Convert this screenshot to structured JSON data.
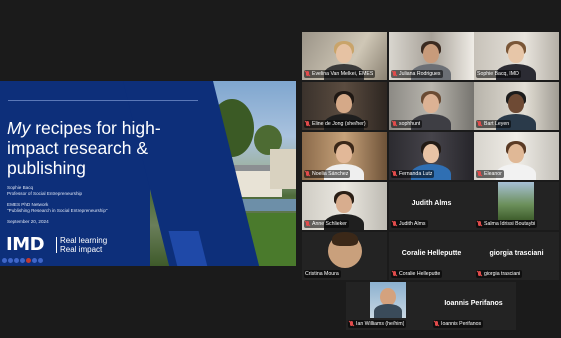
{
  "slide": {
    "title_italic": "My",
    "title_rest": " recipes for high-impact research & publishing",
    "presenter_name": "Sophie Bacq",
    "presenter_role": "Professor of Social Entrepreneurship",
    "network_line1": "EMES PhD Network",
    "network_line2": "\"Publishing Research in Social Entrepreneurship\"",
    "date": "September 20, 2024",
    "logo": "IMD",
    "tagline_1": "Real learning",
    "tagline_2": "Real impact"
  },
  "participants": [
    {
      "name": "Evelina Van Melkei, EMES",
      "video": true,
      "muted": true
    },
    {
      "name": "Juliana Rodrigues",
      "video": true,
      "muted": true
    },
    {
      "name": "Sophie Bacq, IMD",
      "video": true,
      "muted": false,
      "speaking": true
    },
    {
      "name": "Eline de Jong (she/her)",
      "video": true,
      "muted": true
    },
    {
      "name": "sophhunt",
      "video": true,
      "muted": true
    },
    {
      "name": "Bart Leyen",
      "video": true,
      "muted": true
    },
    {
      "name": "Noelia Sánchez",
      "video": true,
      "muted": true
    },
    {
      "name": "Fernanda Lutz",
      "video": true,
      "muted": true
    },
    {
      "name": "Eleanor",
      "video": true,
      "muted": true
    },
    {
      "name": "Anne Schlieker",
      "video": true,
      "muted": true
    },
    {
      "name": "Judith Alms",
      "video": false,
      "muted": true
    },
    {
      "name": "Salma Idrissi Boutaybi",
      "video": true,
      "muted": true
    },
    {
      "name": "Cristina Moura",
      "video": true,
      "muted": true
    },
    {
      "name": "Coralie Helleputte",
      "video": false,
      "muted": true
    },
    {
      "name": "giorgia trasciani",
      "video": false,
      "muted": true
    },
    {
      "name": "Ian Williams (he/him)",
      "video": true,
      "muted": true
    },
    {
      "name": "Ioannis Perifanos",
      "video": false,
      "muted": true
    }
  ]
}
